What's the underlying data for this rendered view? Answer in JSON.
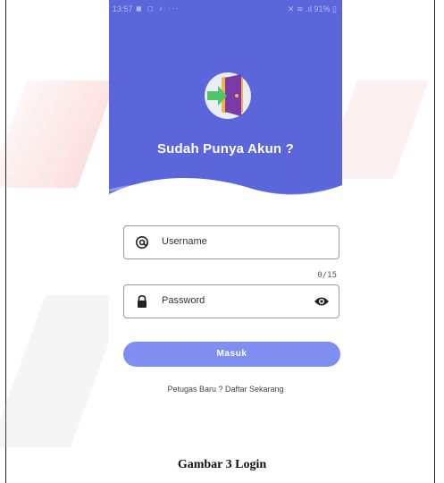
{
  "status_bar": {
    "time": "13:57",
    "left_icons": [
      "notification-icon",
      "instagram-icon",
      "tiktok-icon",
      "more-icon"
    ],
    "left_glyphs": "◼ ◻ ♪ ···",
    "battery": "91%"
  },
  "hero": {
    "title": "Sudah Punya Akun ?",
    "background_color": "#5b66db",
    "icon": "door-enter-icon"
  },
  "form": {
    "username_placeholder": "Username",
    "username_counter": "0/15",
    "password_placeholder": "Password",
    "login_label": "Masuk",
    "login_color": "#7f8ef0"
  },
  "footer": {
    "register_text": "Petugas Baru ? Daftar Sekarang"
  },
  "document": {
    "caption": "Gambar 3 Login"
  }
}
